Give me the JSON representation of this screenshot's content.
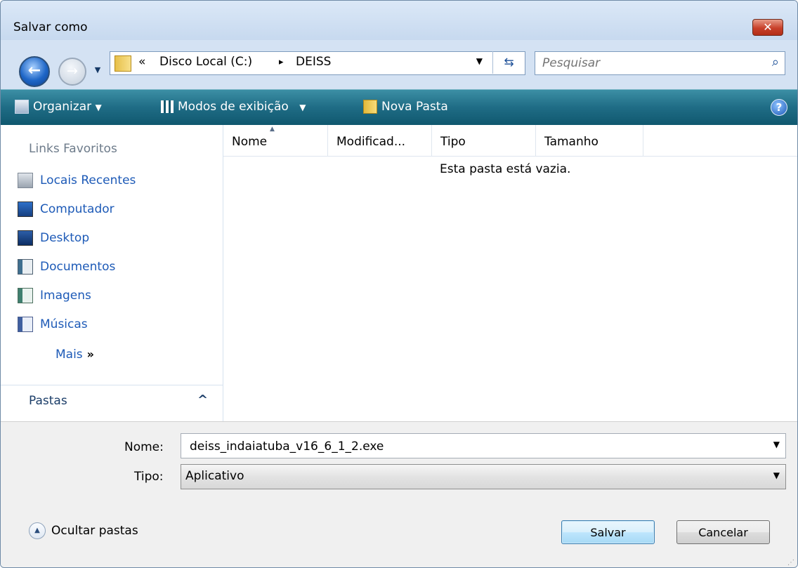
{
  "window": {
    "title": "Salvar como",
    "close_label": "✕"
  },
  "address": {
    "crumbs": [
      "«",
      "Disco Local (C:)",
      "▸",
      "DEISS"
    ]
  },
  "search": {
    "placeholder": "Pesquisar"
  },
  "toolbar": {
    "organize_label": "Organizar",
    "views_label": "Modos de exibição",
    "new_folder_label": "Nova Pasta",
    "help_label": "?"
  },
  "sidebar": {
    "favorites_title": "Links Favoritos",
    "items": [
      {
        "label": "Locais Recentes",
        "icon": "recent-places-icon"
      },
      {
        "label": "Computador",
        "icon": "computer-icon"
      },
      {
        "label": "Desktop",
        "icon": "desktop-icon"
      },
      {
        "label": "Documentos",
        "icon": "documents-icon"
      },
      {
        "label": "Imagens",
        "icon": "pictures-icon"
      },
      {
        "label": "Músicas",
        "icon": "music-icon"
      }
    ],
    "more_label": "Mais",
    "folders_label": "Pastas"
  },
  "filelist": {
    "columns": [
      "Nome",
      "Modificad...",
      "Tipo",
      "Tamanho"
    ],
    "empty_message": "Esta pasta está vazia."
  },
  "form": {
    "name_label": "Nome:",
    "name_value": "deiss_indaiatuba_v16_6_1_2.exe",
    "type_label": "Tipo:",
    "type_value": "Aplicativo"
  },
  "footer": {
    "hide_folders_label": "Ocultar pastas",
    "save_label": "Salvar",
    "cancel_label": "Cancelar"
  }
}
